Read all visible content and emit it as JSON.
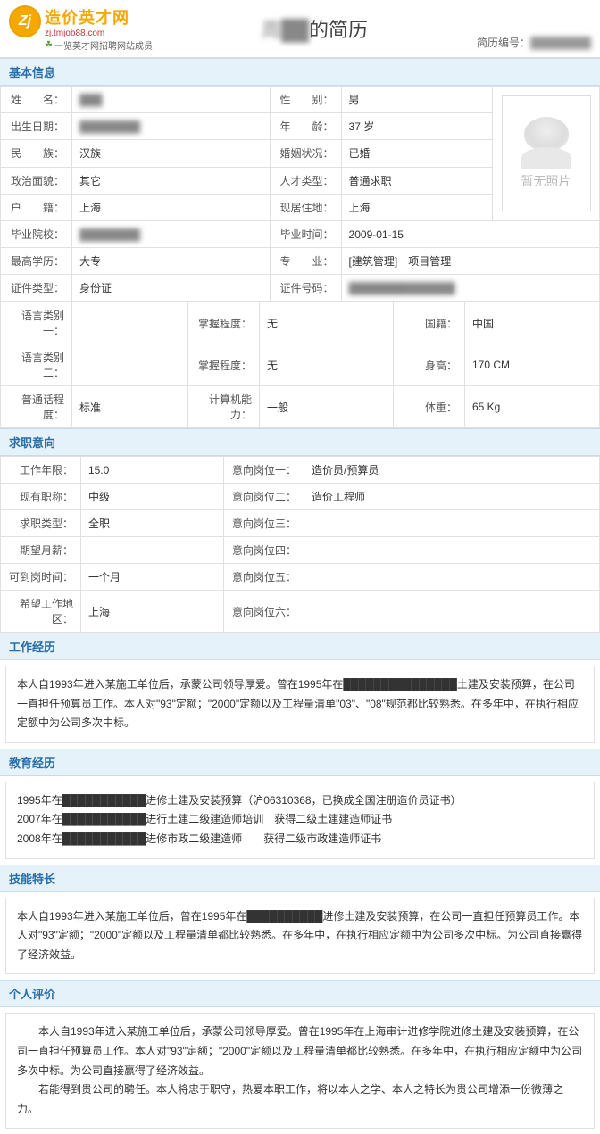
{
  "header": {
    "logo_zj": "Zj",
    "logo_title": "造价英才网",
    "logo_url": "zj.tmjob88.com",
    "logo_tag": "一览英才网招聘网站成员",
    "title_blurred": "周██",
    "title_suffix": "的简历",
    "meta_label": "简历编号：",
    "meta_value": "████████"
  },
  "sections": {
    "basic": "基本信息",
    "intent": "求职意向",
    "work": "工作经历",
    "edu": "教育经历",
    "skill": "技能特长",
    "eval": "个人评价"
  },
  "basic": {
    "name_label": "姓　　名：",
    "name_value": "███",
    "gender_label": "性　　别：",
    "gender_value": "男",
    "birth_label": "出生日期：",
    "birth_value": "████████",
    "age_label": "年　　龄：",
    "age_value": "37 岁",
    "ethnic_label": "民　　族：",
    "ethnic_value": "汉族",
    "marital_label": "婚姻状况：",
    "marital_value": "已婚",
    "politic_label": "政治面貌：",
    "politic_value": "其它",
    "talent_label": "人才类型：",
    "talent_value": "普通求职",
    "huji_label": "户　　籍：",
    "huji_value": "上海",
    "reside_label": "现居住地：",
    "reside_value": "上海",
    "school_label": "毕业院校：",
    "school_value": "████████",
    "gradtime_label": "毕业时间：",
    "gradtime_value": "2009-01-15",
    "edu_label": "最高学历：",
    "edu_value": "大专",
    "major_label": "专　　业：",
    "major_value": "[建筑管理]　项目管理",
    "idtype_label": "证件类型：",
    "idtype_value": "身份证",
    "idno_label": "证件号码：",
    "idno_value": "██████████████",
    "lang1_label": "语言类别一：",
    "lang1_value": "",
    "prof1_label": "掌握程度：",
    "prof1_value": "无",
    "nation_label": "国籍：",
    "nation_value": "中国",
    "lang2_label": "语言类别二：",
    "lang2_value": "",
    "prof2_label": "掌握程度：",
    "prof2_value": "无",
    "height_label": "身高：",
    "height_value": "170 CM",
    "mand_label": "普通话程度：",
    "mand_value": "标准",
    "comp_label": "计算机能力：",
    "comp_value": "一般",
    "weight_label": "体重：",
    "weight_value": "65 Kg",
    "photo_text": "暂无照片"
  },
  "intent": {
    "years_label": "工作年限：",
    "years_value": "15.0",
    "pos1_label": "意向岗位一：",
    "pos1_value": "造价员/预算员",
    "title_label": "现有职称：",
    "title_value": "中级",
    "pos2_label": "意向岗位二：",
    "pos2_value": "造价工程师",
    "type_label": "求职类型：",
    "type_value": "全职",
    "pos3_label": "意向岗位三：",
    "pos3_value": "",
    "salary_label": "期望月薪：",
    "salary_value": "",
    "pos4_label": "意向岗位四：",
    "pos4_value": "",
    "avail_label": "可到岗时间：",
    "avail_value": "一个月",
    "pos5_label": "意向岗位五：",
    "pos5_value": "",
    "loc_label": "希望工作地区：",
    "loc_value": "上海",
    "pos6_label": "意向岗位六：",
    "pos6_value": ""
  },
  "work_text": "本人自1993年进入某施工单位后，承蒙公司领导厚爱。曾在1995年在███████████████土建及安装预算，在公司一直担任预算员工作。本人对\"93\"定额；\"2000\"定额以及工程量清单\"03\"、\"08\"规范都比较熟悉。在多年中，在执行相应定额中为公司多次中标。",
  "edu_text": "1995年在███████████进修土建及安装预算（沪06310368，已换成全国注册造价员证书）\n2007年在███████████进行土建二级建造师培训　获得二级土建建造师证书\n2008年在███████████进修市政二级建造师　　获得二级市政建造师证书",
  "skill_text": "本人自1993年进入某施工单位后，曾在1995年在██████████进修土建及安装预算，在公司一直担任预算员工作。本人对\"93\"定额；\"2000\"定额以及工程量清单都比较熟悉。在多年中，在执行相应定额中为公司多次中标。为公司直接赢得了经济效益。",
  "eval_text": "　　本人自1993年进入某施工单位后，承蒙公司领导厚爱。曾在1995年在上海审计进修学院进修土建及安装预算，在公司一直担任预算员工作。本人对\"93\"定额；\"2000\"定额以及工程量清单都比较熟悉。在多年中，在执行相应定额中为公司多次中标。为公司直接赢得了经济效益。\n　　若能得到贵公司的聘任。本人将忠于职守，热爱本职工作，将以本人之学、本人之特长为贵公司增添一份微薄之力。"
}
